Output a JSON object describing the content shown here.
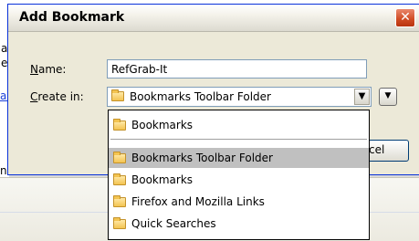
{
  "background": {
    "fragments": [
      "a",
      "e",
      "ali",
      "nl"
    ]
  },
  "dialog": {
    "title": "Add Bookmark",
    "close_label": "✕",
    "name_label_u": "N",
    "name_label_rest": "ame:",
    "name_value": "RefGrab-It",
    "create_label_u": "C",
    "create_label_rest": "reate in:",
    "create_value": "Bookmarks Toolbar Folder",
    "dropdown_arrow": "▼",
    "expand_arrow": "▼",
    "cancel_label_partial": "cel"
  },
  "dropdown": {
    "items": [
      {
        "label": "Bookmarks",
        "selected": false
      },
      {
        "label": "Bookmarks Toolbar Folder",
        "selected": true
      },
      {
        "label": "Bookmarks",
        "selected": false
      },
      {
        "label": "Firefox and Mozilla Links",
        "selected": false
      },
      {
        "label": "Quick Searches",
        "selected": false
      }
    ]
  },
  "colors": {
    "dialog_bg": "#ece9d8",
    "title_border": "#0831d9",
    "selected_bg": "#c0c0c0",
    "close_red": "#cf4a22"
  },
  "icons": {
    "folder": "folder-icon",
    "close": "close-icon",
    "dropdown": "chevron-down-icon"
  }
}
